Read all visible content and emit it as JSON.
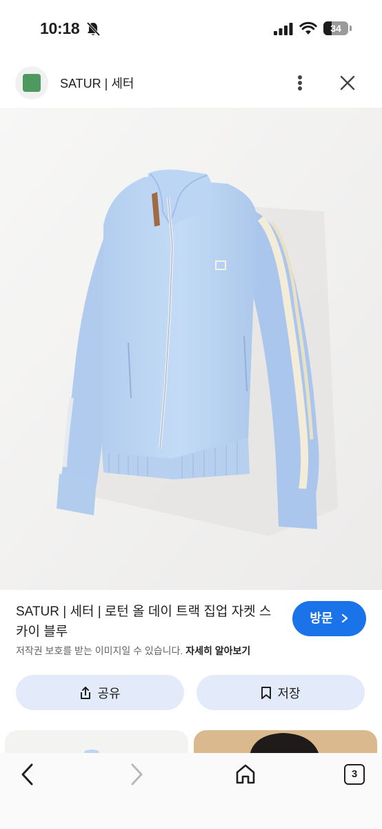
{
  "status_bar": {
    "time": "10:18",
    "battery": "34",
    "icons": [
      "bell-off-icon",
      "cellular-signal-icon",
      "wifi-icon",
      "battery-icon"
    ]
  },
  "header": {
    "site_name": "SATUR | 세터",
    "favicon_color": "#4e9a5e",
    "icons": [
      "more-vert-icon",
      "close-icon"
    ]
  },
  "image": {
    "subject": "light blue zip-up track jacket",
    "colors": {
      "jacket": "#bcd6f3",
      "stripe": "#f2ecd8",
      "background": "#f4f4f4"
    }
  },
  "info": {
    "title": "SATUR | 세터 | 로턴 올 데이 트랙 집업 자켓 스카이 블루",
    "visit_label": "방문",
    "copyright_text": "저작권 보호를 받는 이미지일 수 있습니다.",
    "learn_more": "자세히 알아보기"
  },
  "actions": {
    "share_label": "공유",
    "save_label": "저장"
  },
  "toolbar": {
    "tab_count": "3",
    "icons": [
      "back-icon",
      "forward-icon",
      "home-icon",
      "tabs-icon"
    ]
  },
  "colors": {
    "accent": "#1a73e8",
    "action_bg": "#e3ebfb"
  }
}
